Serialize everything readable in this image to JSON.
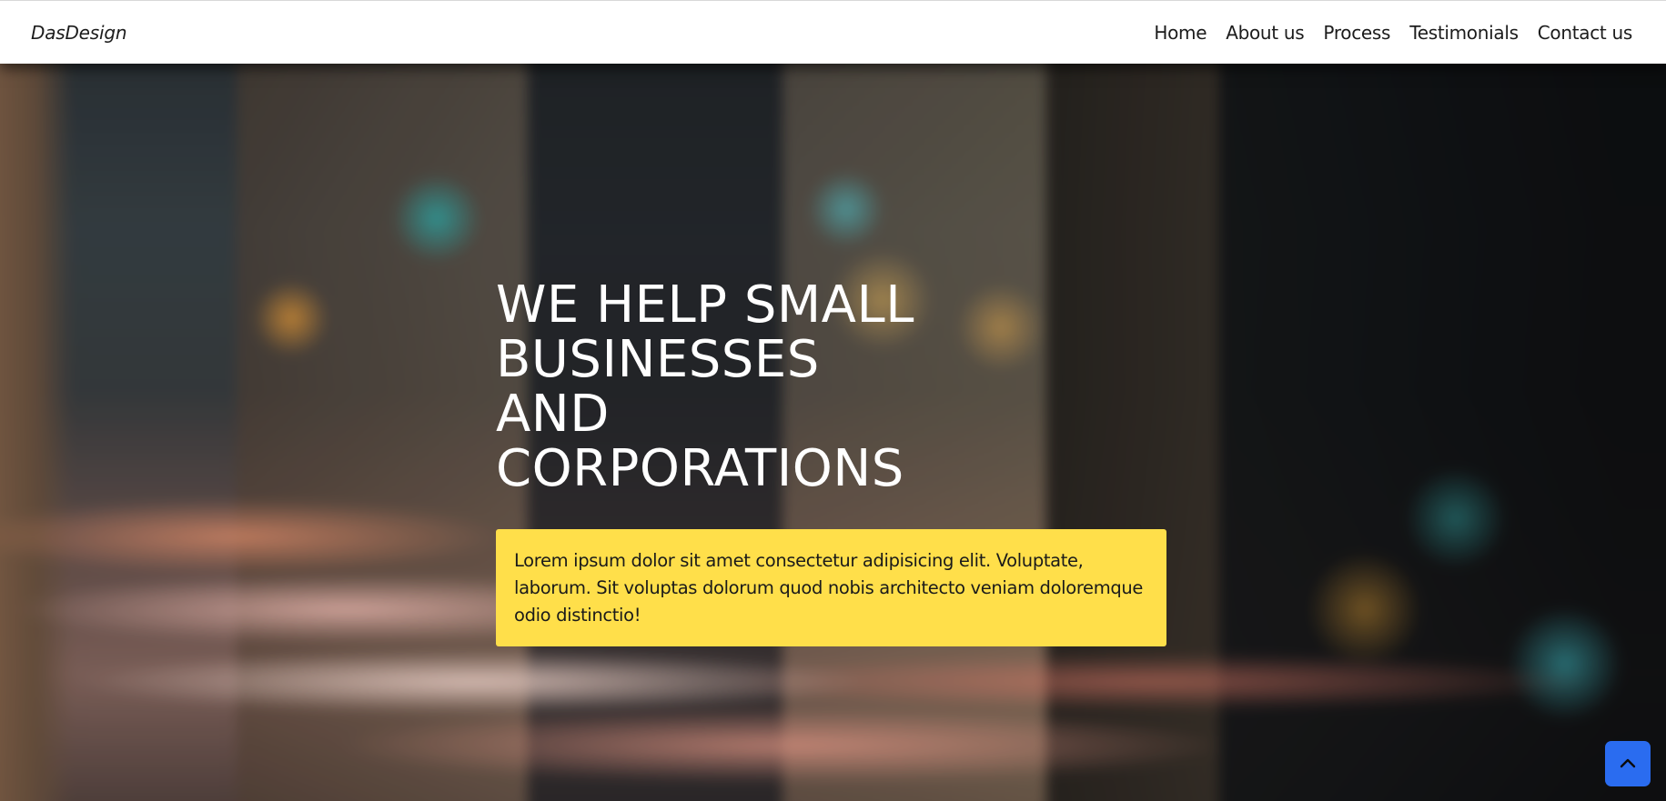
{
  "navbar": {
    "brand": "DasDesign",
    "links": [
      {
        "label": "Home"
      },
      {
        "label": "About us"
      },
      {
        "label": "Process"
      },
      {
        "label": "Testimonials"
      },
      {
        "label": "Contact us"
      }
    ]
  },
  "hero": {
    "title_lines": [
      "WE HELP SMALL",
      "BUSINESSES",
      "AND",
      "CORPORATIONS"
    ],
    "description": "Lorem ipsum dolor sit amet consectetur adipisicing elit. Voluptate, laborum. Sit voluptas dolorum quod nobis architecto veniam doloremque odio distinctio!",
    "box_color": "#ffdf4a"
  },
  "back_to_top": {
    "icon": "chevron-up-icon",
    "color": "#2a6cf0"
  }
}
